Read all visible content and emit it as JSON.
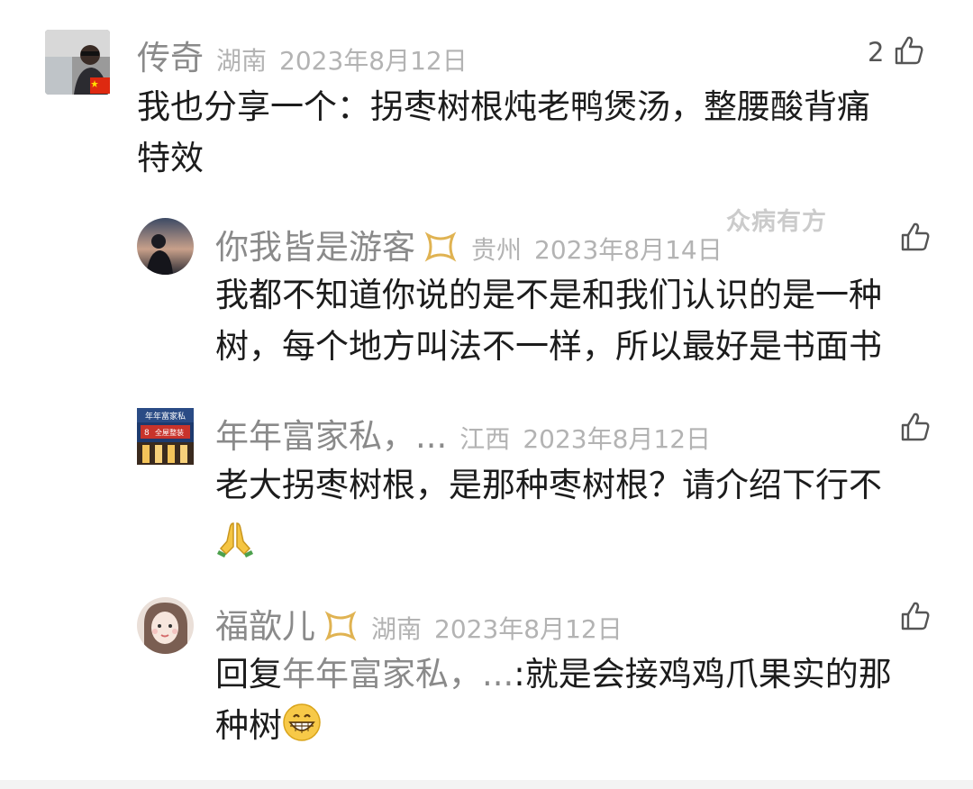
{
  "watermark": "众病有方",
  "comments": [
    {
      "name": "传奇",
      "region": "湖南",
      "date": "2023年8月12日",
      "like_count": "2",
      "lines": [
        "我也分享一个：拐枣树根炖老鸭煲汤，整腰酸背痛",
        "特效"
      ]
    },
    {
      "name": "你我皆是游客",
      "region": "贵州",
      "date": "2023年8月14日",
      "like_count": "",
      "lines": [
        "我都不知道你说的是不是和我们认识的是一种",
        "树，每个地方叫法不一样，所以最好是书面书"
      ]
    },
    {
      "name": "年年富家私，...",
      "region": "江西",
      "date": "2023年8月12日",
      "like_count": "",
      "lines": [
        "老大拐枣树根，是那种枣树根？请介绍下行不"
      ],
      "avatar_sign_top": "年年富家私",
      "avatar_sign_bottom": "全屋整装",
      "avatar_sign_mark": "8"
    },
    {
      "name": "福歆儿",
      "region": "湖南",
      "date": "2023年8月12日",
      "like_count": "",
      "reply_prefix": "回复",
      "reply_to": "年年富家私，...",
      "reply_text": ":就是会接鸡鸡爪果实的那",
      "line2": "种树"
    }
  ],
  "icons": {
    "like": "thumbs-up-icon",
    "badge": "gold-ribbon-badge-icon",
    "flag": "china-flag-icon",
    "pray": "folded-hands-emoji",
    "grin": "grinning-face-emoji"
  },
  "colors": {
    "name": "#8a8a8a",
    "meta": "#b3b3b3",
    "text": "#1c1c1c",
    "badge_gold": "#e0b352"
  }
}
